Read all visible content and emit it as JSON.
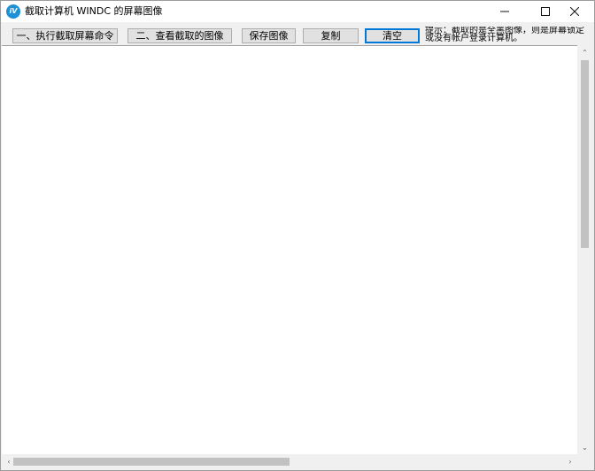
{
  "window": {
    "title": "截取计算机 WINDC 的屏幕图像",
    "icon_glyph": "iV",
    "minimize_icon": "minimize-icon",
    "maximize_icon": "maximize-icon",
    "close_icon": "close-icon"
  },
  "toolbar": {
    "capture_label": "一、执行截取屏幕命令",
    "view_label": "二、查看截取的图像",
    "save_label": "保存图像",
    "copy_label": "复制",
    "clear_label": "清空",
    "hint_line1": "提示：截取的是全黑图像，则是屏幕锁定",
    "hint_line2": "或没有帐户登录计算机。"
  },
  "scrollbars": {
    "up_glyph": "⌃",
    "down_glyph": "⌄",
    "left_glyph": "‹",
    "right_glyph": "›"
  },
  "colors": {
    "accent": "#0078d7",
    "app_icon": "#1e90d6",
    "button_face": "#e1e1e1"
  }
}
